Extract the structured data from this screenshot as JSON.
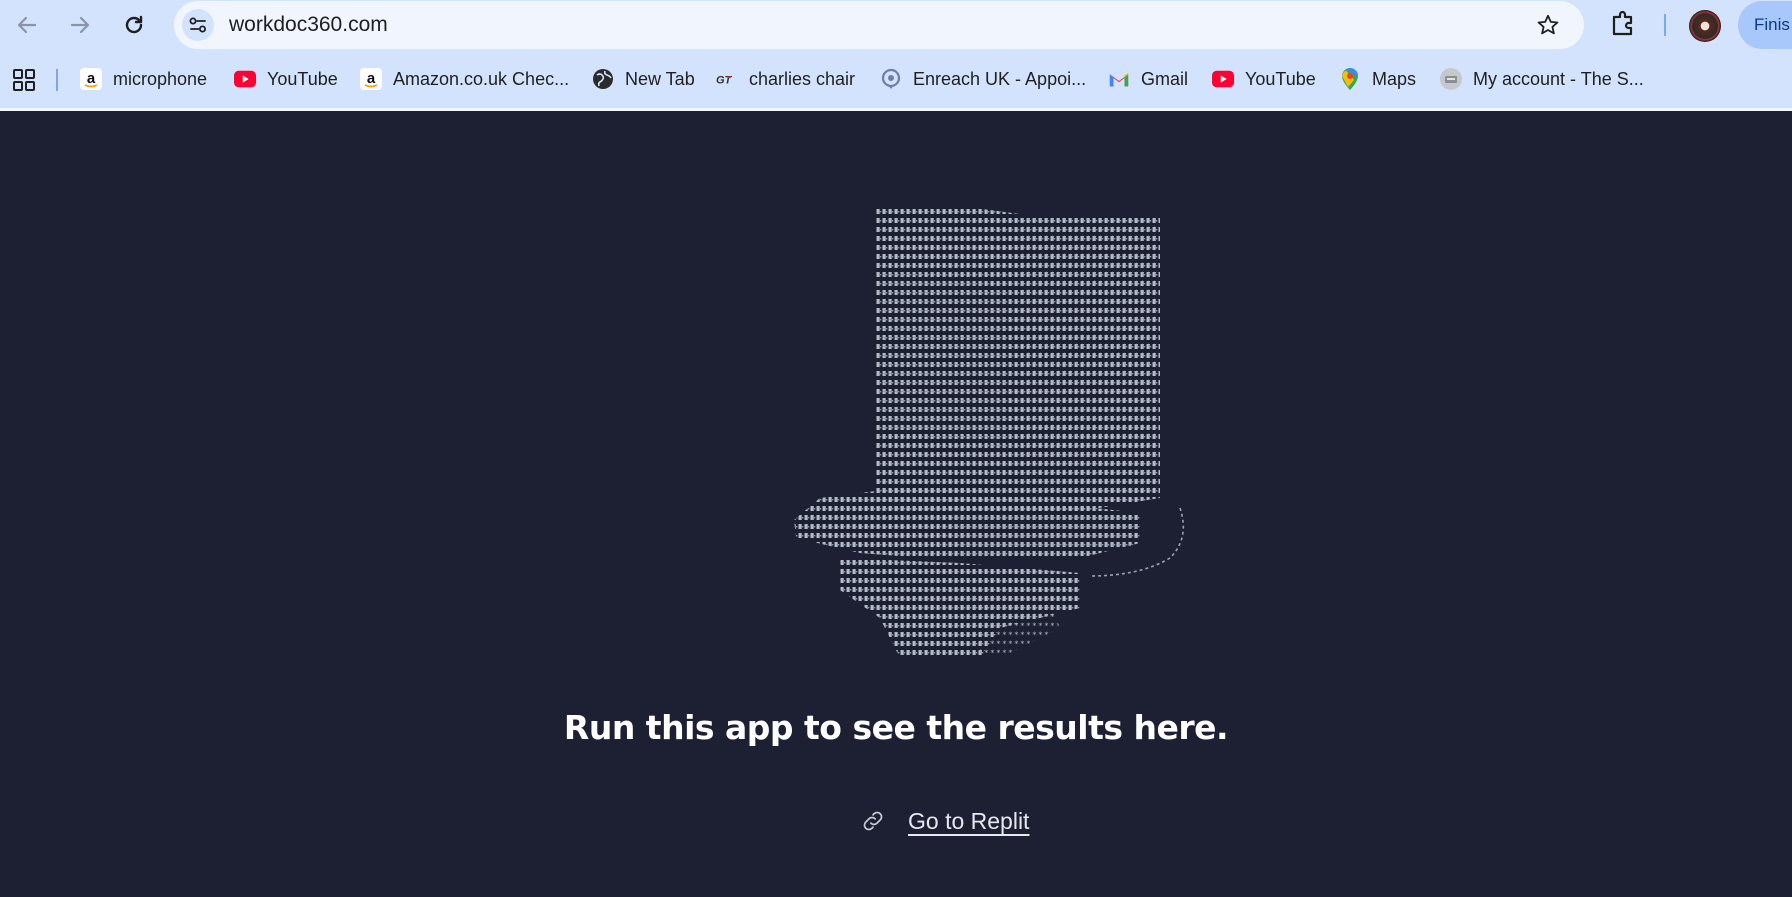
{
  "browser": {
    "url": "workdoc360.com",
    "profile_button_label": "Finis",
    "bookmarks": [
      {
        "label": "microphone",
        "icon": "amazon-icon"
      },
      {
        "label": "YouTube",
        "icon": "youtube-icon"
      },
      {
        "label": "Amazon.co.uk Chec...",
        "icon": "amazon-icon"
      },
      {
        "label": "New Tab",
        "icon": "globe-icon"
      },
      {
        "label": "charlies chair",
        "icon": "gt-icon"
      },
      {
        "label": "Enreach UK - Appoi...",
        "icon": "enreach-icon"
      },
      {
        "label": "Gmail",
        "icon": "gmail-icon"
      },
      {
        "label": "YouTube",
        "icon": "youtube-icon"
      },
      {
        "label": "Maps",
        "icon": "maps-icon"
      },
      {
        "label": "My account - The S...",
        "icon": "account-icon"
      }
    ]
  },
  "page": {
    "headline": "Run this app to see the results here.",
    "cta_label": "Go to Replit",
    "illustration": "ascii-art-chair"
  },
  "colors": {
    "chrome_bg": "#d3e3fd",
    "omnibox_bg": "#f1f5fd",
    "page_bg": "#1c2032",
    "ascii_art": "#b4bac8",
    "youtube_red": "#ff0033",
    "profile_pill": "#a8c7fa"
  }
}
